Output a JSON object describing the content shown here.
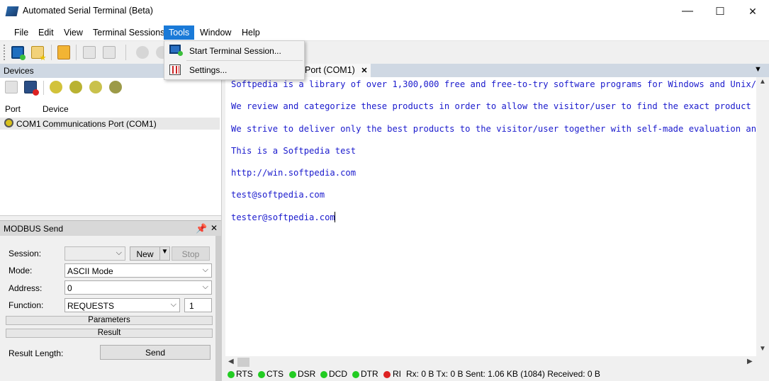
{
  "window": {
    "title": "Automated Serial Terminal (Beta)",
    "minimize": "—",
    "maximize": "☐",
    "close": "✕"
  },
  "menu": [
    "File",
    "Edit",
    "View",
    "Terminal Sessions",
    "Tools",
    "Window",
    "Help"
  ],
  "tools_menu": {
    "start_session": "Start Terminal Session...",
    "settings": "Settings..."
  },
  "devices": {
    "title": "Devices",
    "columns": {
      "port": "Port",
      "device": "Device"
    },
    "rows": [
      {
        "port": "COM1",
        "device": "Communications Port (COM1)"
      }
    ]
  },
  "modbus": {
    "title": "MODBUS Send",
    "session_label": "Session:",
    "session_value": "",
    "new_label": "New",
    "stop_label": "Stop",
    "mode_label": "Mode:",
    "mode_value": "ASCII Mode",
    "address_label": "Address:",
    "address_value": "0",
    "function_label": "Function:",
    "function_value": "REQUESTS",
    "function_count": "1",
    "parameters_label": "Parameters",
    "result_label": "Result",
    "result_length_label": "Result Length:",
    "send_label": "Send"
  },
  "terminal": {
    "tab_label": "Port (COM1)",
    "tab_close": "✕",
    "lines": [
      "Softpedia is a library of over 1,300,000 free and free-to-try software programs for Windows and Unix/",
      "We review and categorize these products in order to allow the visitor/user to find the exact product",
      "We strive to deliver only the best products to the visitor/user together with self-made evaluation an",
      "This is a Softpedia test",
      "http://win.softpedia.com",
      "test@softpedia.com",
      "tester@softpedia.com"
    ]
  },
  "status": {
    "signals": [
      {
        "name": "RTS",
        "state": "on",
        "color": "#22cc22"
      },
      {
        "name": "CTS",
        "state": "on",
        "color": "#22cc22"
      },
      {
        "name": "DSR",
        "state": "on",
        "color": "#22cc22"
      },
      {
        "name": "DCD",
        "state": "on",
        "color": "#22cc22"
      },
      {
        "name": "DTR",
        "state": "on",
        "color": "#22cc22"
      },
      {
        "name": "RI",
        "state": "off",
        "color": "#dd2222"
      }
    ],
    "counters": "Rx: 0 B Tx: 0 B Sent: 1.06 KB (1084) Received: 0 B"
  }
}
